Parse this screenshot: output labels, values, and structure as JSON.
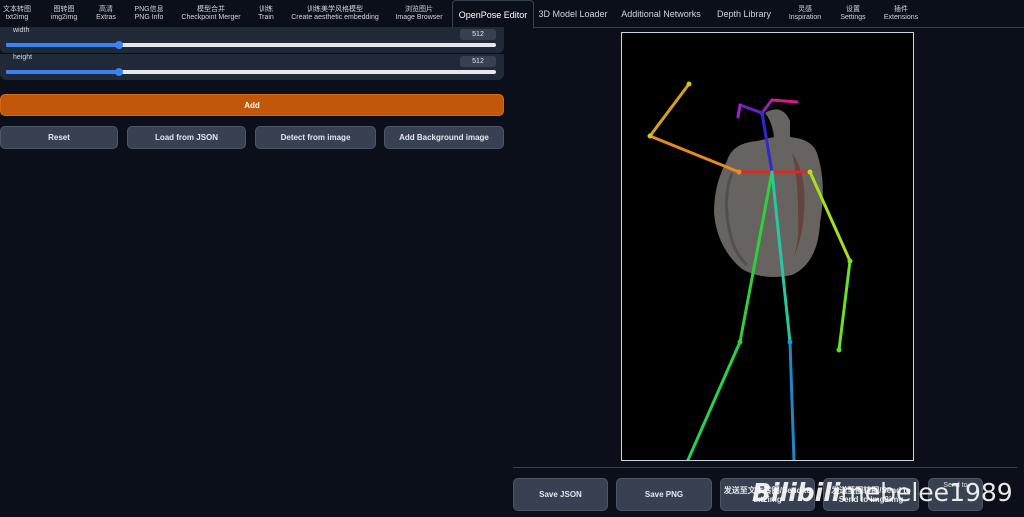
{
  "tabs": [
    {
      "l1": "文本转图",
      "l2": "txt2img"
    },
    {
      "l1": "图转图",
      "l2": "img2img"
    },
    {
      "l1": "高清",
      "l2": "Extras"
    },
    {
      "l1": "PNG信息",
      "l2": "PNG Info"
    },
    {
      "l1": "模型合并",
      "l2": "Checkpoint Merger"
    },
    {
      "l1": "训练",
      "l2": "Train"
    },
    {
      "l1": "训练美学风格模型",
      "l2": "Create aesthetic embedding"
    },
    {
      "l1": "浏览图片",
      "l2": "Image Browser"
    },
    {
      "label": "OpenPose Editor"
    },
    {
      "label": "3D Model Loader"
    },
    {
      "label": "Additional Networks"
    },
    {
      "label": "Depth Library"
    },
    {
      "l1": "灵感",
      "l2": "Inspiration"
    },
    {
      "l1": "设置",
      "l2": "Settings"
    },
    {
      "l1": "插件",
      "l2": "Extensions"
    }
  ],
  "sliders": {
    "width": {
      "label": "width",
      "value": "512",
      "fraction": 0.23
    },
    "height": {
      "label": "height",
      "value": "512",
      "fraction": 0.23
    }
  },
  "buttons": {
    "add": "Add",
    "reset": "Reset",
    "load_json": "Load from JSON",
    "detect": "Detect from image",
    "add_bg": "Add Background image"
  },
  "bottom": {
    "save_json": "Save JSON",
    "save_png": "Save PNG",
    "send_txt2img_l1": "发送至文本转图/Send to",
    "send_txt2img_l2": "txt2img",
    "send_img2img_l1": "发送至图转图/Send to",
    "send_img2img_l2": "Send to img2img",
    "send_to": "Send to"
  },
  "watermark": {
    "logo": "Bilibili",
    "user": "mebelee1989"
  },
  "colors": {
    "accent_orange": "#c2570c",
    "slider_blue": "#3b82f6",
    "background": "#0b0f19"
  }
}
